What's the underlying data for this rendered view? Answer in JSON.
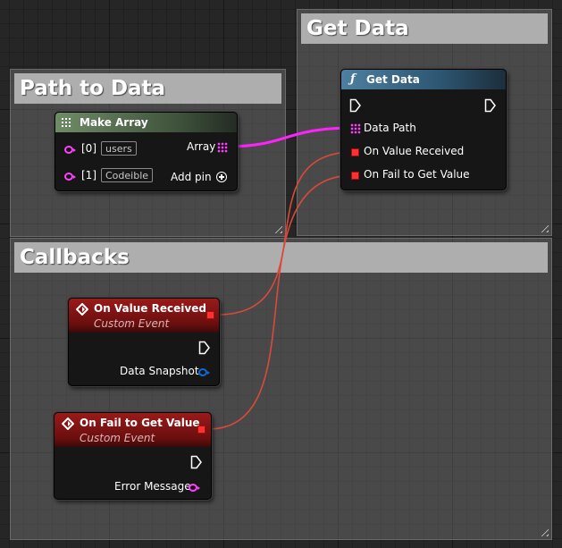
{
  "comments": {
    "get_data": "Get Data",
    "path_to_data": "Path to Data",
    "callbacks": "Callbacks"
  },
  "make_array": {
    "title": "Make Array",
    "pins": [
      {
        "index": "[0]",
        "value": "users"
      },
      {
        "index": "[1]",
        "value": "Codeible"
      }
    ],
    "output_label": "Array",
    "add_pin_label": "Add pin"
  },
  "get_data_node": {
    "function_icon": "ƒ",
    "title": "Get Data",
    "inputs": [
      "Data Path",
      "On Value Received",
      "On Fail to Get Value"
    ]
  },
  "event_value": {
    "title": "On Value Received",
    "subtitle": "Custom Event",
    "output_label": "Data Snapshot"
  },
  "event_fail": {
    "title": "On Fail to Get Value",
    "subtitle": "Custom Event",
    "output_label": "Error Message"
  },
  "colors": {
    "array_wire": "#ff22ff",
    "delegate_wire": "#d94a3a",
    "event_header": "#8a1414",
    "function_header": "#2d5f7e",
    "make_array_header": "#5a7a56"
  },
  "icons": {
    "event": "event-diamond-icon",
    "function": "function-f-icon",
    "make_array": "make-array-icon",
    "exec": "exec-arrow-icon",
    "add_pin": "add-pin-plus-icon"
  }
}
